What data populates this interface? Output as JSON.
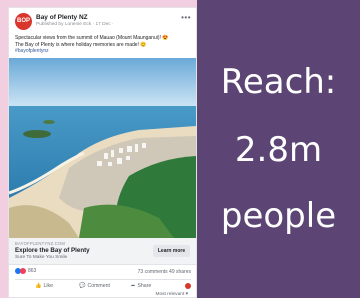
{
  "post": {
    "page_name": "Bay of Plenty NZ",
    "published_by": "Published by Lonenie Eck · 17 Dec ·",
    "avatar_text": "BOP",
    "caption_line1": "Spectacular views from the summit of Mauao (Mount Maunganui)! 😍",
    "caption_line2": "The Bay of Plenty is where holiday memories are made! 😊",
    "hashtag": "#bayofplentynz",
    "link_domain": "BAYOFPLENTYNZ.COM",
    "link_title": "Explore the Bay of Plenty",
    "link_desc": "Sure To Make You Smile",
    "cta": "Learn more",
    "reaction_count": "863",
    "comments_shares": "73 comments 49 shares",
    "actions": {
      "like": "Like",
      "comment": "Comment",
      "share": "Share"
    },
    "sort": "Most relevant ▾"
  },
  "panel": {
    "line1": "Reach:",
    "line2": "2.8m",
    "line3": "people"
  },
  "colors": {
    "panel_bg": "#5c4575",
    "frame_bg": "#f2cfe0",
    "brand_red": "#d9372b",
    "fb_blue": "#1877f2"
  },
  "icons": [
    "more-icon",
    "like-icon",
    "comment-icon",
    "share-icon",
    "love-reaction-icon",
    "like-reaction-icon"
  ]
}
